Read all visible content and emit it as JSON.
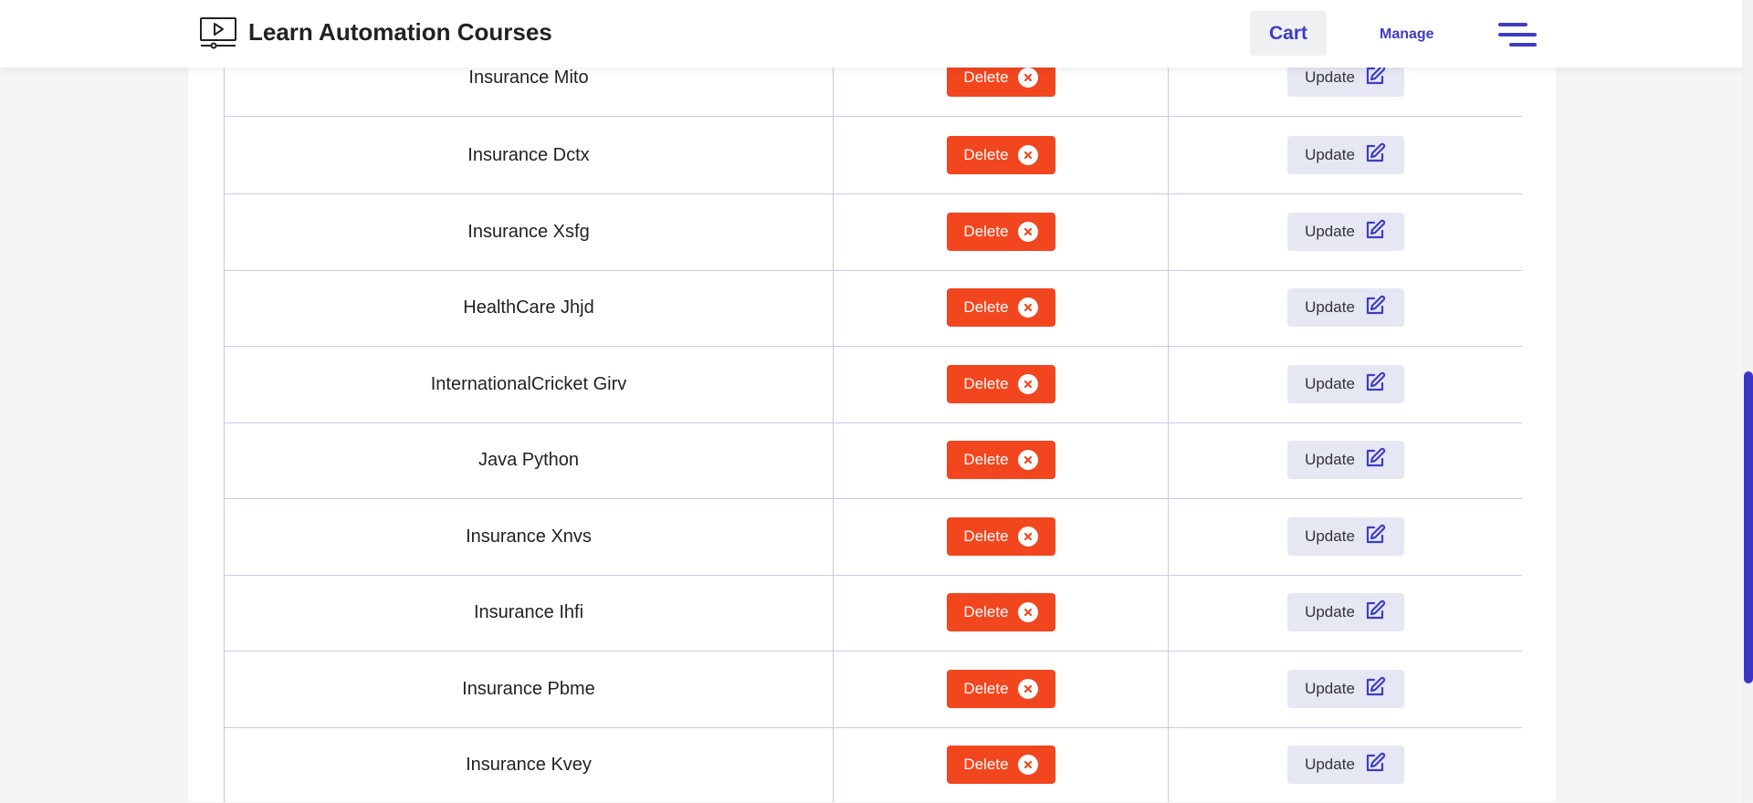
{
  "header": {
    "title": "Learn Automation Courses",
    "logo_icon": "video-player-icon",
    "cart_label": "Cart",
    "manage_label": "Manage",
    "menu_icon": "hamburger-menu-icon"
  },
  "table": {
    "rows": [
      {
        "name": "Insurance Mito",
        "delete_label": "Delete",
        "update_label": "Update"
      },
      {
        "name": "Insurance Dctx",
        "delete_label": "Delete",
        "update_label": "Update"
      },
      {
        "name": "Insurance Xsfg",
        "delete_label": "Delete",
        "update_label": "Update"
      },
      {
        "name": "HealthCare Jhjd",
        "delete_label": "Delete",
        "update_label": "Update"
      },
      {
        "name": "InternationalCricket Girv",
        "delete_label": "Delete",
        "update_label": "Update"
      },
      {
        "name": "Java Python",
        "delete_label": "Delete",
        "update_label": "Update"
      },
      {
        "name": "Insurance Xnvs",
        "delete_label": "Delete",
        "update_label": "Update"
      },
      {
        "name": "Insurance Ihfi",
        "delete_label": "Delete",
        "update_label": "Update"
      },
      {
        "name": "Insurance Pbme",
        "delete_label": "Delete",
        "update_label": "Update"
      },
      {
        "name": "Insurance Kvey",
        "delete_label": "Delete",
        "update_label": "Update"
      }
    ]
  },
  "colors": {
    "accent": "#3f3cc2",
    "delete": "#f2461f",
    "update_bg": "#e5e8f3",
    "grid_line": "#c9c9ee"
  }
}
